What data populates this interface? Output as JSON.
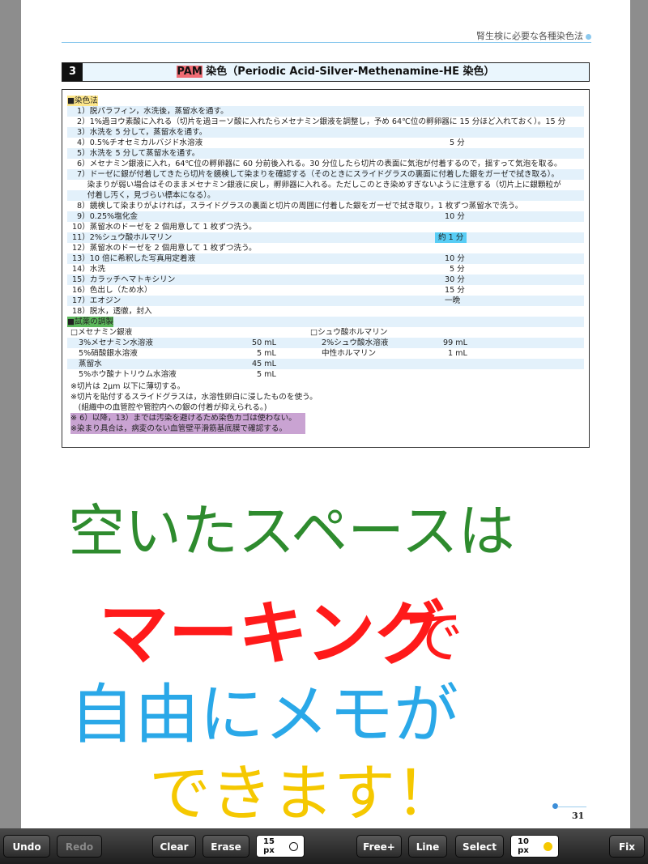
{
  "header": {
    "running_title": "腎生検に必要な各種染色法"
  },
  "section": {
    "number": "3",
    "title_highlight": "PAM",
    "title_rest": " 染色（Periodic Acid-Silver-Methenamine-HE 染色）"
  },
  "procedure": {
    "heading": "■染色法",
    "steps": [
      {
        "text": "1）脱パラフィン，水洗後，蒸留水を通す。",
        "time": ""
      },
      {
        "text": "2）1%過ヨウ素酸に入れる（切片を過ヨーソ酸に入れたらメセナミン銀液を調整し，予め 64℃位の孵卵器に 15 分ほど入れておく）。15 分",
        "time": ""
      },
      {
        "text": "3）水洗を 5 分して，蒸留水を通す。",
        "time": ""
      },
      {
        "text": "4）0.5%チオセミカルバジド水溶液",
        "time": "5 分"
      },
      {
        "text": "5）水洗を 5 分して蒸留水を通す。",
        "time": ""
      },
      {
        "text": "6）メセナミン銀液に入れ，64℃位の孵卵器に 60 分前後入れる。30 分位したら切片の表面に気泡が付着するので，揺すって気泡を取る。",
        "time": ""
      },
      {
        "text": "7）ドーゼに銀が付着してきたら切片を鏡検して染まりを確認する（そのときにスライドグラスの裏面に付着した銀をガーゼで拭き取る）。",
        "time": ""
      },
      {
        "text": "　 染まりが弱い場合はそのままメセナミン銀液に戻し，孵卵器に入れる。ただしこのとき染めすぎないように注意する（切片上に銀顆粒が",
        "time": ""
      },
      {
        "text": "　 付着し汚く，見づらい標本になる）。",
        "time": ""
      },
      {
        "text": "8）鏡検して染まりがよければ，スライドグラスの裏面と切片の周囲に付着した銀をガーゼで拭き取り，1 枚ずつ蒸留水で洗う。",
        "time": ""
      },
      {
        "text": "9）0.25%塩化金",
        "time": "10 分"
      },
      {
        "text": "10）蒸留水のドーゼを 2 個用意して 1 枚ずつ洗う。",
        "time": ""
      },
      {
        "text": "11）2%シュウ酸ホルマリン",
        "time": "約 1 分"
      },
      {
        "text": "12）蒸留水のドーゼを 2 個用意して 1 枚ずつ洗う。",
        "time": ""
      },
      {
        "text": "13）10 倍に希釈した写真用定着液",
        "time": "10 分"
      },
      {
        "text": "14）水洗",
        "time": "5 分"
      },
      {
        "text": "15）カラッチヘマトキシリン",
        "time": "30 分"
      },
      {
        "text": "16）色出し（ため水）",
        "time": "15 分"
      },
      {
        "text": "17）エオジン",
        "time": "一晩"
      },
      {
        "text": "18）脱水，透徹，封入",
        "time": ""
      }
    ]
  },
  "reagents": {
    "heading": "■試薬の調製",
    "left_title": "□メセナミン銀液",
    "left_items": [
      {
        "name": "3%メセナミン水溶液",
        "amount": "50 mL"
      },
      {
        "name": "5%硝酸銀水溶液",
        "amount": "5 mL"
      },
      {
        "name": "蒸留水",
        "amount": "45 mL"
      },
      {
        "name": "5%ホウ酸ナトリウム水溶液",
        "amount": "5 mL"
      }
    ],
    "right_title": "□シュウ酸ホルマリン",
    "right_items": [
      {
        "name": "2%シュウ酸水溶液",
        "amount": "99 mL"
      },
      {
        "name": "中性ホルマリン",
        "amount": "1 mL"
      }
    ]
  },
  "notes": [
    "※切片は 2μm 以下に薄切する。",
    "※切片を貼付するスライドグラスは，水溶性卵白に浸したものを使う。",
    "　(組織中の血管腔や管腔内への銀の付着が抑えられる。)",
    "※ 6）以降，13）までは汚染を避けるため染色カゴは使わない。",
    "※染まり具合は，病変のない血管壁平滑筋基底膜で確認する。"
  ],
  "handwriting": {
    "line1": "空いたスペースは",
    "line2a": "マーキング",
    "line2b": "で",
    "line3": "自由にメモが",
    "line4": "できます！"
  },
  "page_number": "31",
  "toolbar": {
    "undo": "Undo",
    "redo": "Redo",
    "clear": "Clear",
    "erase": "Erase",
    "eraser_size": "15",
    "free_plus": "Free+",
    "line": "Line",
    "select": "Select",
    "pen_size": "10",
    "unit": "px",
    "fix": "Fix"
  },
  "colors": {
    "highlight_red": "#f06c74",
    "highlight_yellow": "#fde68a",
    "highlight_green": "#5cb85c",
    "highlight_cyan": "#58cdf5",
    "highlight_purple": "#c9a3d2",
    "ink_green": "#2e8b2e",
    "ink_red": "#ff1a1a",
    "ink_blue": "#2aa8e8",
    "ink_yellow": "#f5c800",
    "pen_color": "#f5c800"
  }
}
